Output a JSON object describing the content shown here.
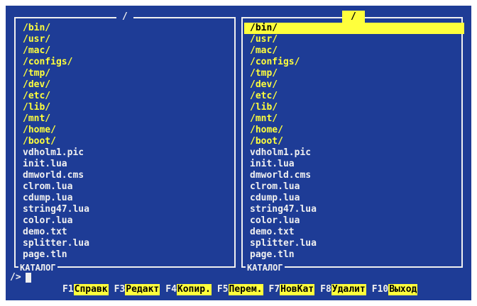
{
  "left_panel": {
    "title": "/",
    "footer": "КАТАЛОГ",
    "items": [
      {
        "name": "/bin/",
        "type": "dir"
      },
      {
        "name": "/usr/",
        "type": "dir"
      },
      {
        "name": "/mac/",
        "type": "dir"
      },
      {
        "name": "/configs/",
        "type": "dir"
      },
      {
        "name": "/tmp/",
        "type": "dir"
      },
      {
        "name": "/dev/",
        "type": "dir"
      },
      {
        "name": "/etc/",
        "type": "dir"
      },
      {
        "name": "/lib/",
        "type": "dir"
      },
      {
        "name": "/mnt/",
        "type": "dir"
      },
      {
        "name": "/home/",
        "type": "dir"
      },
      {
        "name": "/boot/",
        "type": "dir"
      },
      {
        "name": "vdholm1.pic",
        "type": "file"
      },
      {
        "name": "init.lua",
        "type": "file"
      },
      {
        "name": "dmworld.cms",
        "type": "file"
      },
      {
        "name": "clrom.lua",
        "type": "file"
      },
      {
        "name": "cdump.lua",
        "type": "file"
      },
      {
        "name": "string47.lua",
        "type": "file"
      },
      {
        "name": "color.lua",
        "type": "file"
      },
      {
        "name": "demo.txt",
        "type": "file"
      },
      {
        "name": "splitter.lua",
        "type": "file"
      },
      {
        "name": "page.tln",
        "type": "file"
      }
    ]
  },
  "right_panel": {
    "title": "/",
    "footer": "КАТАЛОГ",
    "selected_index": 0,
    "items": [
      {
        "name": "/bin/",
        "type": "dir"
      },
      {
        "name": "/usr/",
        "type": "dir"
      },
      {
        "name": "/mac/",
        "type": "dir"
      },
      {
        "name": "/configs/",
        "type": "dir"
      },
      {
        "name": "/tmp/",
        "type": "dir"
      },
      {
        "name": "/dev/",
        "type": "dir"
      },
      {
        "name": "/etc/",
        "type": "dir"
      },
      {
        "name": "/lib/",
        "type": "dir"
      },
      {
        "name": "/mnt/",
        "type": "dir"
      },
      {
        "name": "/home/",
        "type": "dir"
      },
      {
        "name": "/boot/",
        "type": "dir"
      },
      {
        "name": "vdholm1.pic",
        "type": "file"
      },
      {
        "name": "init.lua",
        "type": "file"
      },
      {
        "name": "dmworld.cms",
        "type": "file"
      },
      {
        "name": "clrom.lua",
        "type": "file"
      },
      {
        "name": "cdump.lua",
        "type": "file"
      },
      {
        "name": "string47.lua",
        "type": "file"
      },
      {
        "name": "color.lua",
        "type": "file"
      },
      {
        "name": "demo.txt",
        "type": "file"
      },
      {
        "name": "splitter.lua",
        "type": "file"
      },
      {
        "name": "page.tln",
        "type": "file"
      }
    ]
  },
  "prompt": "/>",
  "function_keys": [
    {
      "key": "F1",
      "label": "Справк"
    },
    {
      "key": "F3",
      "label": "Редакт"
    },
    {
      "key": "F4",
      "label": "Копир."
    },
    {
      "key": "F5",
      "label": "Перем."
    },
    {
      "key": "F7",
      "label": "НовКат"
    },
    {
      "key": "F8",
      "label": "Удалит"
    },
    {
      "key": "F10",
      "label": "Выход"
    }
  ],
  "colors": {
    "background": "#1e3c96",
    "directory": "#ffff3c",
    "file": "#f0f0f0",
    "highlight": "#ffff3c"
  }
}
